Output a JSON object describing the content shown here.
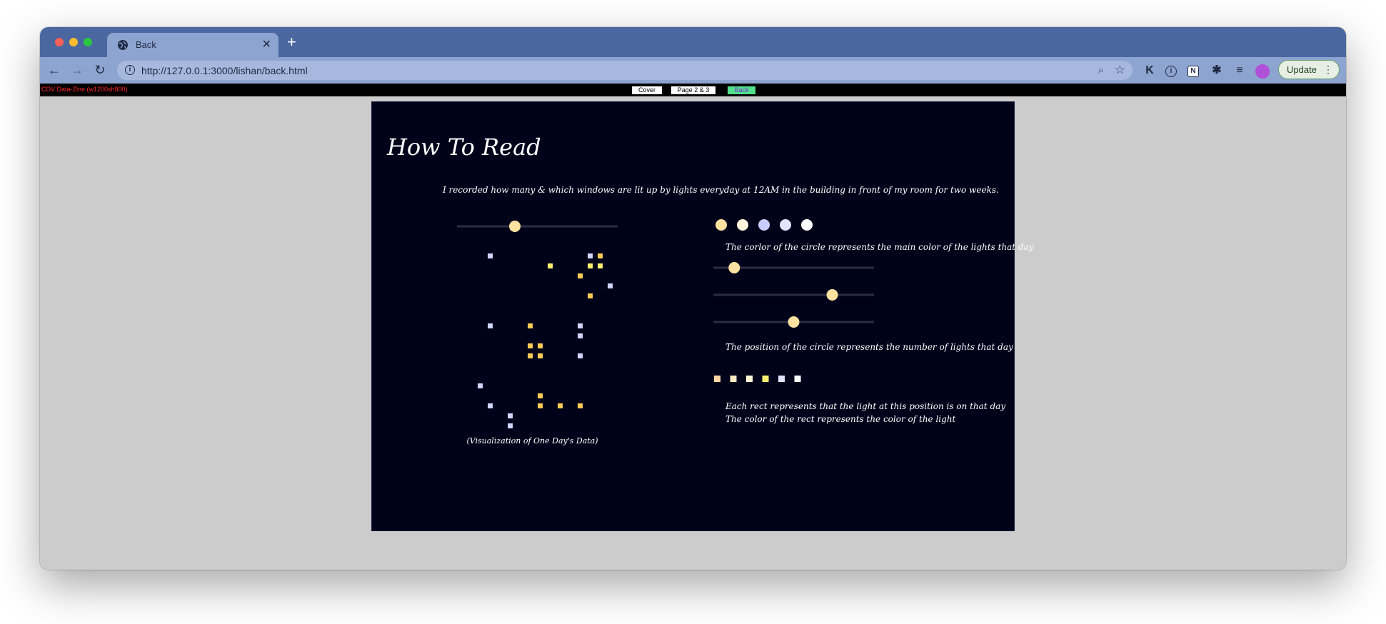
{
  "browser": {
    "tab_title": "Back",
    "url": "http://127.0.0.1:3000/lishan/back.html",
    "update_label": "Update"
  },
  "page_nav": {
    "tag": "CDV Data-Zine (w1200xh800)",
    "cover_label": "Cover",
    "pages_label": "Page 2 & 3",
    "back_label": "Back"
  },
  "page": {
    "title": "How To Read",
    "intro": "I recorded how many & which windows are lit up by lights everyday at 12AM in the building in front of my room for two weeks.",
    "caption": "(Visualization of One Day's Data)",
    "legend": {
      "color_text": "The corlor of the circle represents the main color of the lights that day",
      "position_text": "The position of the circle represents the number of lights that day",
      "rect_text_1": "Each rect represents that the light at this position is on that day",
      "rect_text_2": "The color of the rect represents the color of the light"
    }
  },
  "colors": {
    "background": "#00021a",
    "warm": "#ffe2a0",
    "yellow": "#fff170",
    "orange": "#ffcc55",
    "lavender": "#d2d6ff",
    "white": "#ffffff",
    "track": "#2b2d42"
  },
  "viz": {
    "slider_value": 0.36,
    "windows": [
      {
        "row": 0,
        "col": 1,
        "color": "lavender"
      },
      {
        "row": 1,
        "col": 7,
        "color": "yellow"
      },
      {
        "row": 0,
        "col": 11,
        "color": "lavender"
      },
      {
        "row": 0,
        "col": 12,
        "color": "orange"
      },
      {
        "row": 1,
        "col": 11,
        "color": "yellow"
      },
      {
        "row": 1,
        "col": 12,
        "color": "yellow"
      },
      {
        "row": 2,
        "col": 10,
        "color": "orange"
      },
      {
        "row": 3,
        "col": 13,
        "color": "lavender"
      },
      {
        "row": 4,
        "col": 11,
        "color": "orange"
      },
      {
        "row": 7,
        "col": 1,
        "color": "lavender"
      },
      {
        "row": 7,
        "col": 5,
        "color": "orange"
      },
      {
        "row": 7,
        "col": 10,
        "color": "lavender"
      },
      {
        "row": 8,
        "col": 10,
        "color": "lavender"
      },
      {
        "row": 9,
        "col": 5,
        "color": "orange"
      },
      {
        "row": 9,
        "col": 6,
        "color": "orange"
      },
      {
        "row": 10,
        "col": 5,
        "color": "orange"
      },
      {
        "row": 10,
        "col": 6,
        "color": "orange"
      },
      {
        "row": 10,
        "col": 10,
        "color": "lavender"
      },
      {
        "row": 13,
        "col": 0,
        "color": "lavender"
      },
      {
        "row": 14,
        "col": 6,
        "color": "orange"
      },
      {
        "row": 15,
        "col": 1,
        "color": "lavender"
      },
      {
        "row": 15,
        "col": 6,
        "color": "orange"
      },
      {
        "row": 15,
        "col": 8,
        "color": "orange"
      },
      {
        "row": 15,
        "col": 10,
        "color": "orange"
      },
      {
        "row": 16,
        "col": 3,
        "color": "lavender"
      },
      {
        "row": 17,
        "col": 3,
        "color": "lavender"
      }
    ]
  },
  "legend_circles": [
    "#ffe2a0",
    "#fff3dc",
    "#c9ccff",
    "#e0e4ff",
    "#ffffff"
  ],
  "legend_sliders": [
    0.13,
    0.74,
    0.5
  ],
  "legend_rects": [
    "#ffd7a0",
    "#ffe9c2",
    "#fff6d8",
    "#fff170",
    "#dfe3ff",
    "#ffffff"
  ]
}
